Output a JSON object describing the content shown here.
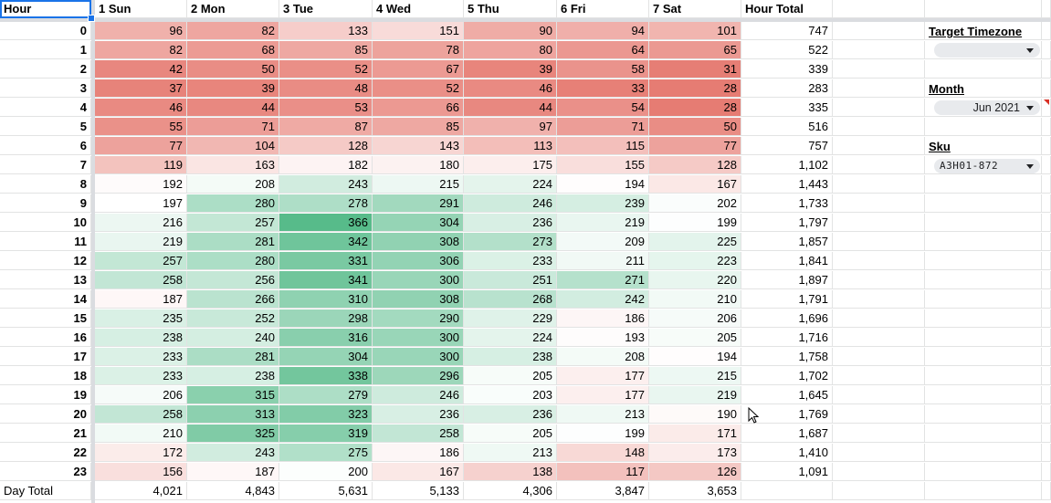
{
  "sheet": {
    "corner_header": "Hour",
    "day_headers": [
      "1 Sun",
      "2 Mon",
      "3 Tue",
      "4 Wed",
      "5 Thu",
      "6 Fri",
      "7 Sat"
    ],
    "hour_total_header": "Hour Total",
    "footer_label": "Day Total",
    "heatmap_colors": {
      "min": "#e67c73",
      "mid": "#ffffff",
      "max": "#57bb8a"
    },
    "rows": [
      {
        "hour": "0",
        "values": [
          96,
          82,
          133,
          151,
          90,
          94,
          101
        ],
        "total": "747"
      },
      {
        "hour": "1",
        "values": [
          82,
          68,
          85,
          78,
          80,
          64,
          65
        ],
        "total": "522"
      },
      {
        "hour": "2",
        "values": [
          42,
          50,
          52,
          67,
          39,
          58,
          31
        ],
        "total": "339"
      },
      {
        "hour": "3",
        "values": [
          37,
          39,
          48,
          52,
          46,
          33,
          28
        ],
        "total": "283"
      },
      {
        "hour": "4",
        "values": [
          46,
          44,
          53,
          66,
          44,
          54,
          28
        ],
        "total": "335"
      },
      {
        "hour": "5",
        "values": [
          55,
          71,
          87,
          85,
          97,
          71,
          50
        ],
        "total": "516"
      },
      {
        "hour": "6",
        "values": [
          77,
          104,
          128,
          143,
          113,
          115,
          77
        ],
        "total": "757"
      },
      {
        "hour": "7",
        "values": [
          119,
          163,
          182,
          180,
          175,
          155,
          128
        ],
        "total": "1,102"
      },
      {
        "hour": "8",
        "values": [
          192,
          208,
          243,
          215,
          224,
          194,
          167
        ],
        "total": "1,443"
      },
      {
        "hour": "9",
        "values": [
          197,
          280,
          278,
          291,
          246,
          239,
          202
        ],
        "total": "1,733"
      },
      {
        "hour": "10",
        "values": [
          216,
          257,
          366,
          304,
          236,
          219,
          199
        ],
        "total": "1,797"
      },
      {
        "hour": "11",
        "values": [
          219,
          281,
          342,
          308,
          273,
          209,
          225
        ],
        "total": "1,857"
      },
      {
        "hour": "12",
        "values": [
          257,
          280,
          331,
          306,
          233,
          211,
          223
        ],
        "total": "1,841"
      },
      {
        "hour": "13",
        "values": [
          258,
          256,
          341,
          300,
          251,
          271,
          220
        ],
        "total": "1,897"
      },
      {
        "hour": "14",
        "values": [
          187,
          266,
          310,
          308,
          268,
          242,
          210
        ],
        "total": "1,791"
      },
      {
        "hour": "15",
        "values": [
          235,
          252,
          298,
          290,
          229,
          186,
          206
        ],
        "total": "1,696"
      },
      {
        "hour": "16",
        "values": [
          238,
          240,
          316,
          300,
          224,
          193,
          205
        ],
        "total": "1,716"
      },
      {
        "hour": "17",
        "values": [
          233,
          281,
          304,
          300,
          238,
          208,
          194
        ],
        "total": "1,758"
      },
      {
        "hour": "18",
        "values": [
          233,
          238,
          338,
          296,
          205,
          177,
          215
        ],
        "total": "1,702"
      },
      {
        "hour": "19",
        "values": [
          206,
          315,
          279,
          246,
          203,
          177,
          219
        ],
        "total": "1,645"
      },
      {
        "hour": "20",
        "values": [
          258,
          313,
          323,
          236,
          236,
          213,
          190
        ],
        "total": "1,769"
      },
      {
        "hour": "21",
        "values": [
          210,
          325,
          319,
          258,
          205,
          199,
          171
        ],
        "total": "1,687"
      },
      {
        "hour": "22",
        "values": [
          172,
          243,
          275,
          186,
          213,
          148,
          173
        ],
        "total": "1,410"
      },
      {
        "hour": "23",
        "values": [
          156,
          187,
          200,
          167,
          138,
          117,
          126
        ],
        "total": "1,091"
      }
    ],
    "day_totals": [
      "4,021",
      "4,843",
      "5,631",
      "5,133",
      "4,306",
      "3,847",
      "3,653"
    ]
  },
  "controls": {
    "timezone": {
      "label": "Target Timezone",
      "value": ""
    },
    "month": {
      "label": "Month",
      "value": "Jun 2021"
    },
    "sku": {
      "label": "Sku",
      "value": "A3H01-872"
    }
  }
}
